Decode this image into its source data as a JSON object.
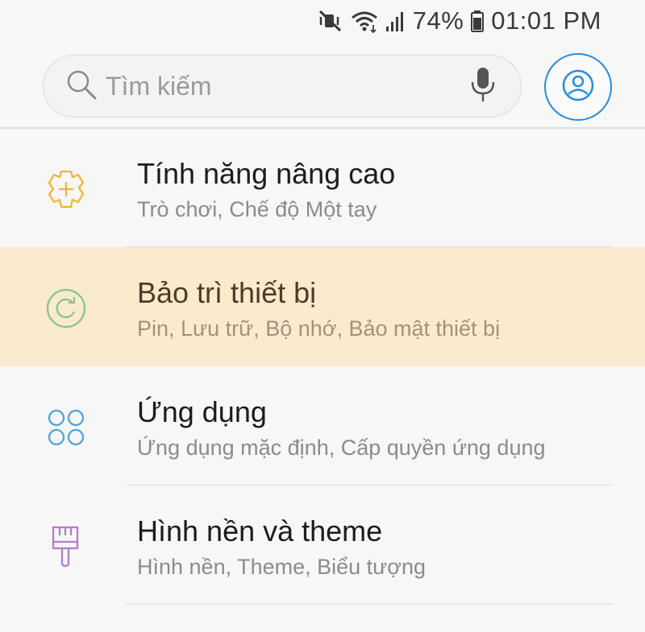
{
  "status_bar": {
    "battery": "74%",
    "time": "01:01 PM",
    "icons": [
      "vibrate-mute-icon",
      "wifi-icon",
      "signal-icon",
      "battery-icon"
    ]
  },
  "search": {
    "placeholder": "Tìm kiếm"
  },
  "settings": {
    "items": [
      {
        "title": "Tính năng nâng cao",
        "subtitle": "Trò chơi, Chế độ Một tay",
        "icon": "advanced-features-gear-plus-icon",
        "icon_color": "#f0b53a"
      },
      {
        "title": "Bảo trì thiết bị",
        "subtitle": "Pin, Lưu trữ, Bộ nhớ, Bảo mật thiết bị",
        "icon": "device-maintenance-refresh-icon",
        "icon_color": "#8fc28c",
        "highlighted": true
      },
      {
        "title": "Ứng dụng",
        "subtitle": "Ứng dụng mặc định, Cấp quyền ứng dụng",
        "icon": "apps-grid-icon",
        "icon_color": "#4ea4d6"
      },
      {
        "title": "Hình nền và theme",
        "subtitle": "Hình nền, Theme, Biểu tượng",
        "icon": "paintbrush-icon",
        "icon_color": "#b37ec9"
      }
    ]
  },
  "colors": {
    "background": "#f7f7f7",
    "highlight": "#faebcf",
    "profile_accent": "#2b8bd6"
  }
}
